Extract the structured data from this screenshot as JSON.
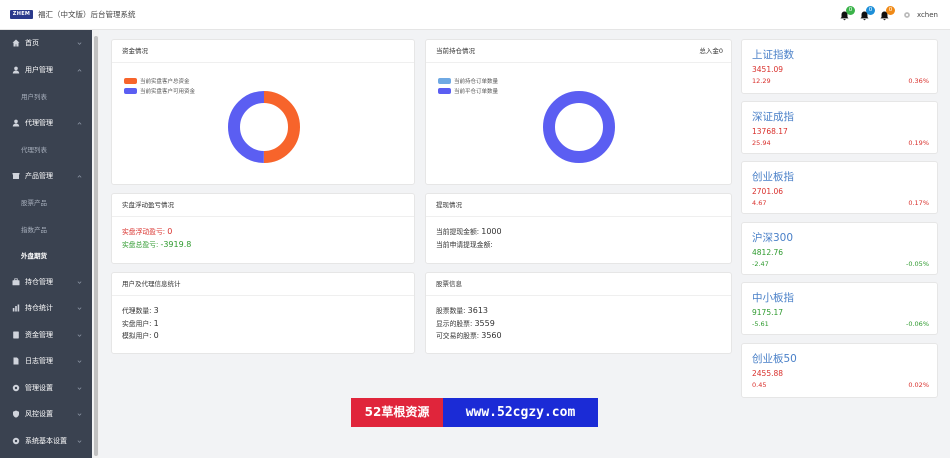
{
  "header": {
    "logo_text": "ZHEM",
    "title": "福汇（中文版）后台管理系统",
    "notifications": [
      {
        "count": "0",
        "color": "#3bb34a"
      },
      {
        "count": "0",
        "color": "#1e8fd8"
      },
      {
        "count": "0",
        "color": "#f08a17"
      }
    ],
    "username": "xchen"
  },
  "sidebar": {
    "items": [
      {
        "label": "首页",
        "icon": "home-icon"
      },
      {
        "label": "用户管理",
        "icon": "user-icon"
      },
      {
        "label": "用户列表",
        "sub": true
      },
      {
        "label": "代理管理",
        "icon": "user-tie-icon"
      },
      {
        "label": "代理列表",
        "sub": true
      },
      {
        "label": "产品管理",
        "icon": "box-icon"
      },
      {
        "label": "股票产品",
        "sub": true
      },
      {
        "label": "指数产品",
        "sub": true
      },
      {
        "label": "外盘期货",
        "sub": true,
        "active": true
      },
      {
        "label": "持仓管理",
        "icon": "briefcase-icon"
      },
      {
        "label": "持仓统计",
        "icon": "chart-icon"
      },
      {
        "label": "资金管理",
        "icon": "money-icon"
      },
      {
        "label": "日志管理",
        "icon": "file-icon"
      },
      {
        "label": "管理设置",
        "icon": "settings-icon"
      },
      {
        "label": "风控设置",
        "icon": "shield-icon"
      },
      {
        "label": "系统基本设置",
        "icon": "cog-icon"
      }
    ]
  },
  "funds": {
    "title": "资金情况",
    "legend": [
      {
        "label": "当前实盘客户总资金",
        "color": "#f7642b"
      },
      {
        "label": "当前实盘客户可用资金",
        "color": "#5b5ef2"
      }
    ],
    "slices": [
      0.5,
      0.5
    ]
  },
  "positions": {
    "title": "当前持仓情况",
    "extra": "总入金0",
    "legend": [
      {
        "label": "当前持仓订单数量",
        "color": "#6fa9e3"
      },
      {
        "label": "当前平仓订单数量",
        "color": "#5b5ef2"
      }
    ],
    "slices": [
      0,
      1
    ]
  },
  "pnl": {
    "title": "实盘浮动盈亏情况",
    "float_label": "实盘浮动盈亏:",
    "float_value": "0",
    "total_label": "实盘总盈亏:",
    "total_value": "-3919.8"
  },
  "withdraw": {
    "title": "提现情况",
    "done_label": "当前提现金额:",
    "done_value": "1000",
    "apply_label": "当前申请提现金额:",
    "apply_value": ""
  },
  "stats": {
    "title": "用户及代理信息统计",
    "agents_label": "代理数量:",
    "agents_value": "3",
    "real_label": "实盘用户:",
    "real_value": "1",
    "sim_label": "模拟用户:",
    "sim_value": "0"
  },
  "stocks": {
    "title": "股票信息",
    "count_label": "股票数量:",
    "count_value": "3613",
    "shown_label": "显示的股票:",
    "shown_value": "3559",
    "trade_label": "可交易的股票:",
    "trade_value": "3560"
  },
  "indices": [
    {
      "name": "上证指数",
      "price": "3451.09",
      "change": "12.29",
      "pct": "0.36%",
      "trend": "up"
    },
    {
      "name": "深证成指",
      "price": "13768.17",
      "change": "25.94",
      "pct": "0.19%",
      "trend": "up"
    },
    {
      "name": "创业板指",
      "price": "2701.06",
      "change": "4.67",
      "pct": "0.17%",
      "trend": "up"
    },
    {
      "name": "沪深300",
      "price": "4812.76",
      "change": "-2.47",
      "pct": "-0.05%",
      "trend": "down"
    },
    {
      "name": "中小板指",
      "price": "9175.17",
      "change": "-5.61",
      "pct": "-0.06%",
      "trend": "down"
    },
    {
      "name": "创业板50",
      "price": "2455.88",
      "change": "0.45",
      "pct": "0.02%",
      "trend": "up"
    }
  ],
  "watermark": {
    "left_text": "52草根资源",
    "right_text": "www.52cgzy.com"
  }
}
